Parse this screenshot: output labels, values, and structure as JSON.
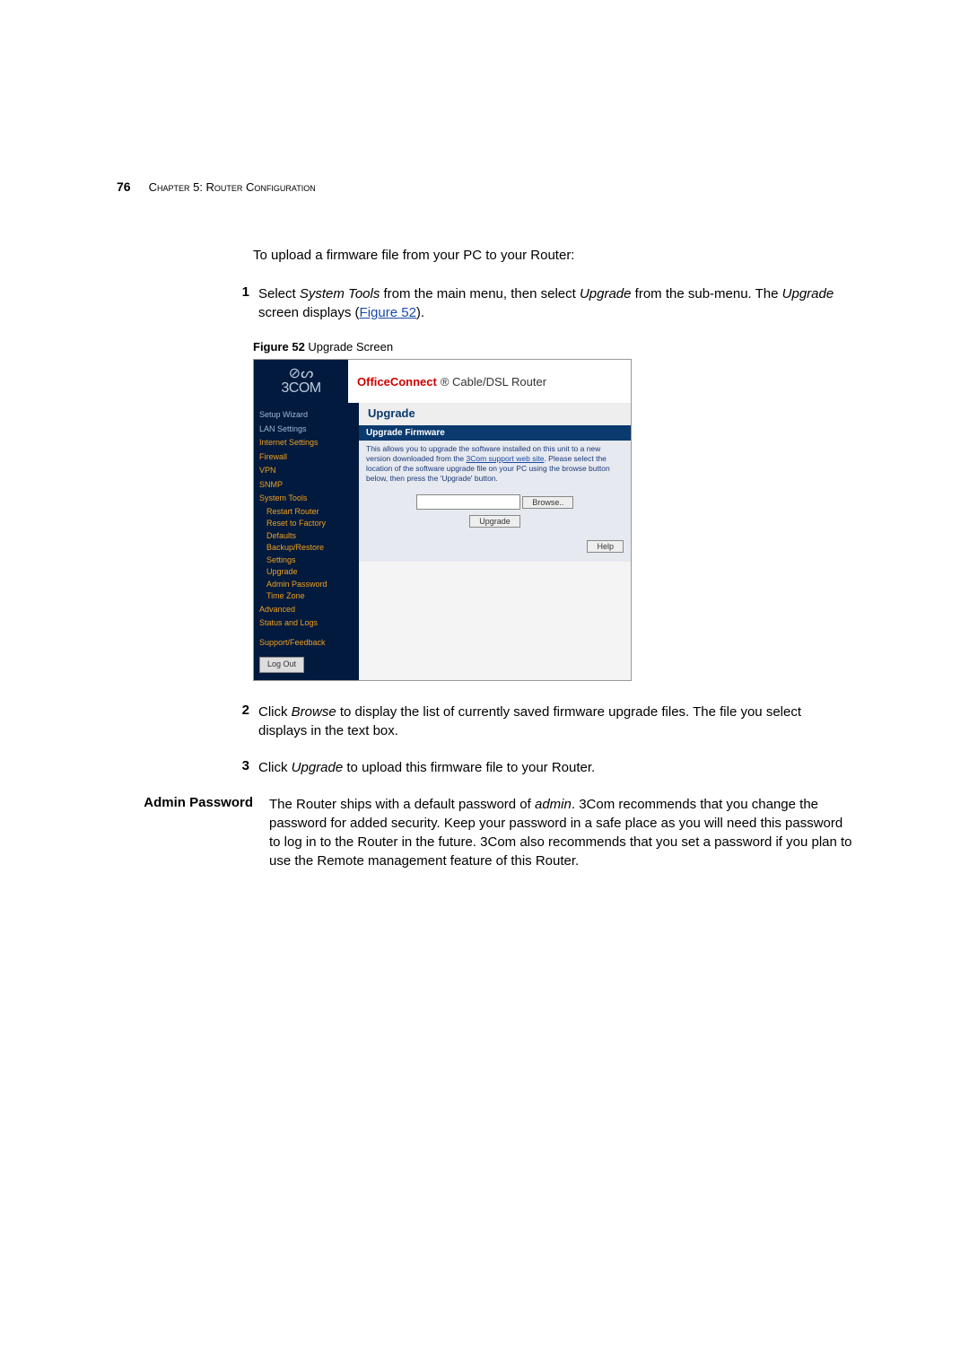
{
  "header": {
    "page_num": "76",
    "chapter": "Chapter 5: Router Configuration"
  },
  "intro": "To upload a firmware file from your PC to your Router:",
  "step1": {
    "num": "1",
    "before_st": "Select ",
    "st": "System Tools",
    "mid": " from the main menu, then select ",
    "up": "Upgrade",
    "after": " from the sub-menu. The ",
    "up2": "Upgrade",
    "after2": " screen displays (",
    "link": "Figure 52",
    "after3": ")."
  },
  "figure": {
    "label": "Figure 52",
    "caption": "   Upgrade Screen"
  },
  "screenshot": {
    "brand": "3COM",
    "title_bold": "OfficeConnect",
    "title_rest": "® Cable/DSL Router",
    "nav": {
      "setup": "Setup Wizard",
      "lan": "LAN Settings",
      "internet": "Internet Settings",
      "firewall": "Firewall",
      "vpn": "VPN",
      "snmp": "SNMP",
      "system": "System Tools",
      "restart": "Restart Router",
      "reset": "Reset to Factory Defaults",
      "backup": "Backup/Restore Settings",
      "upgrade": "Upgrade",
      "admin": "Admin Password",
      "tz": "Time Zone",
      "advanced": "Advanced",
      "status": "Status and Logs",
      "support": "Support/Feedback",
      "logout": "Log Out"
    },
    "h1": "Upgrade",
    "bar": "Upgrade Firmware",
    "desc_before": "This allows you to upgrade the software installed on this unit to a new version downloaded from the ",
    "desc_link": "3Com support web site",
    "desc_after": ". Please select the location of the software upgrade file on your PC using the browse button below, then press the 'Upgrade' button.",
    "browse": "Browse..",
    "upgrade_btn": "Upgrade",
    "help": "Help"
  },
  "step2": {
    "num": "2",
    "before": "Click ",
    "italic": "Browse",
    "after": " to display the list of currently saved firmware upgrade files. The file you select displays in the text box."
  },
  "step3": {
    "num": "3",
    "before": "Click ",
    "italic": "Upgrade",
    "after": " to upload this firmware file to your Router."
  },
  "admin_section": {
    "label": "Admin Password",
    "body_before": "The Router ships with a default password of ",
    "italic": "admin",
    "body_after": ". 3Com recommends that you change the password for added security. Keep your password in a safe place as you will need this password to log in to the Router in the future. 3Com also recommends that you set a password if you plan to use the Remote management feature of this Router."
  }
}
